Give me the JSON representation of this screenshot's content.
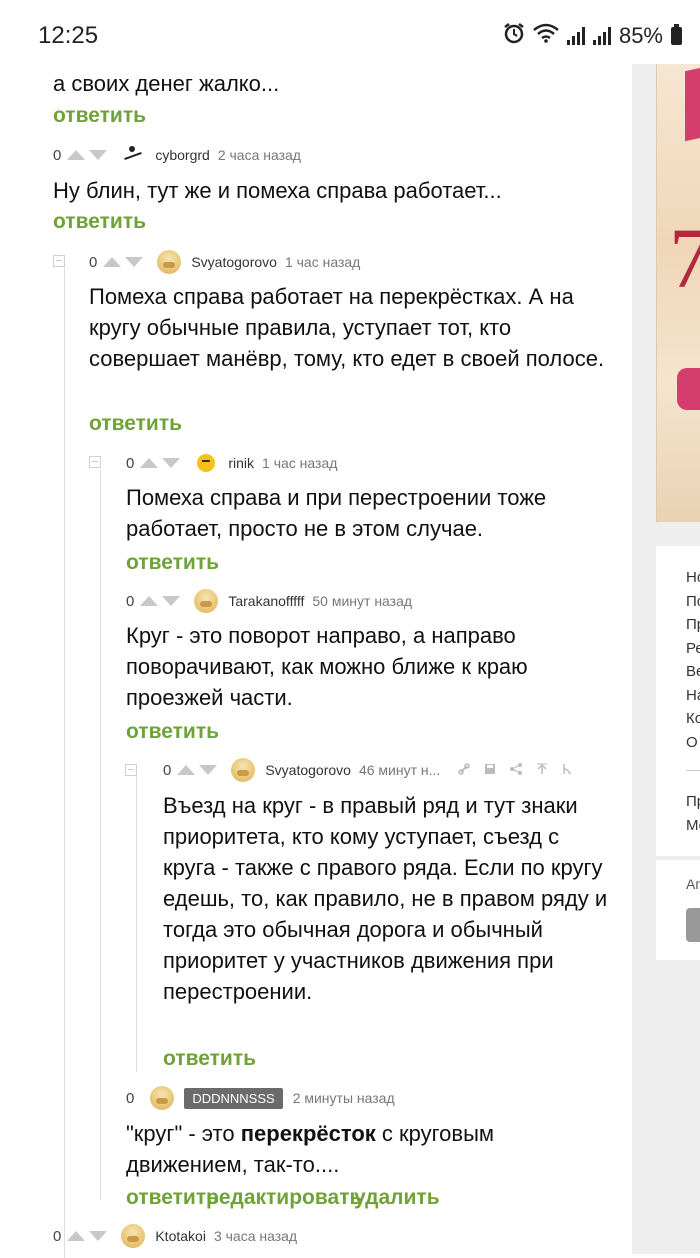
{
  "status_bar": {
    "time": "12:25",
    "battery": "85%",
    "icons": [
      "alarm-icon",
      "wifi-icon",
      "signal-icon",
      "signal-icon",
      "battery-icon"
    ]
  },
  "colors": {
    "reply_green": "#6fa237",
    "ad_pink": "#d43d6e",
    "badge_gray": "#6b6b6b"
  },
  "comments": [
    {
      "id": "c0",
      "text_partial_top": "...",
      "text_line2": "а своих денег жалко...",
      "reply_label": "ответить"
    },
    {
      "id": "c1",
      "score": "0",
      "user": "cyborgrd",
      "time": "2 часа назад",
      "text": "Ну блин, тут же и помеха справа работает...",
      "reply_label": "ответить"
    },
    {
      "id": "c2",
      "score": "0",
      "user": "Svyatogorovo",
      "time": "1 час назад",
      "text": "Помеха справа работает на перекрёстках. А на кругу обычные правила, уступает тот, кто совершает манёвр, тому, кто едет в своей полосе.",
      "reply_label": "ответить"
    },
    {
      "id": "c3",
      "score": "0",
      "user": "rinik",
      "time": "1 час назад",
      "text": "Помеха справа и при перестроении тоже работает, просто не в этом случае.",
      "reply_label": "ответить"
    },
    {
      "id": "c4",
      "score": "0",
      "user": "Tarakanofffff",
      "time": "50 минут назад",
      "text": "Круг - это поворот направо, а направо поворачивают, как можно ближе к краю проезжей части.",
      "reply_label": "ответить"
    },
    {
      "id": "c5",
      "score": "0",
      "user": "Svyatogorovo",
      "time": "46 минут н...",
      "text": "Въезд на круг - в правый ряд и тут знаки приоритета, кто кому уступает, съезд с круга - также с правого ряда. Если по кругу едешь, то, как правило, не в правом ряду и тогда это обычная дорога и обычный приоритет у участников движения при перестроении.",
      "reply_label": "ответить"
    },
    {
      "id": "c6",
      "score": "0",
      "user": "DDDNNNSSS",
      "time": "2 минуты назад",
      "text_a": "\"круг\" - это ",
      "text_bold": "перекрёсток",
      "text_b": " с круговым движением, так-то....",
      "reply_label": "ответить",
      "edit_label": "редактировать",
      "delete_label": "удалить"
    },
    {
      "id": "c7",
      "score": "0",
      "user": "Ktotakoi",
      "time": "3 часа назад"
    }
  ],
  "sidebar": {
    "ad_digit": "7",
    "ad_badge": "Б",
    "list_a": [
      "Но",
      "По",
      "Пр",
      "Ре",
      "Ве",
      "На",
      "Ко",
      "О"
    ],
    "list_b": [
      "Пр",
      "Мо"
    ],
    "ap": "Ап"
  }
}
